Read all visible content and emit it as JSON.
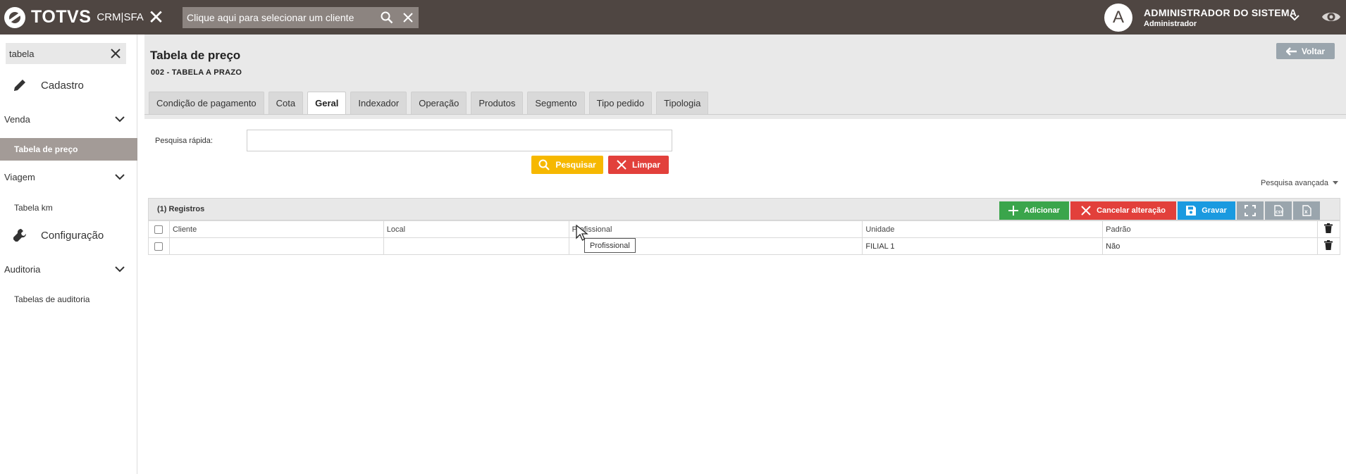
{
  "topbar": {
    "brand": "TOTVS",
    "product": "CRM|SFA",
    "client_search_placeholder": "Clique aqui para selecionar um cliente",
    "user_initial": "A",
    "user_name": "ADMINISTRADOR DO SISTEMA",
    "user_role": "Administrador"
  },
  "sidebar": {
    "search_value": "tabela",
    "items": [
      {
        "label": "Cadastro",
        "icon": "pencil-icon"
      },
      {
        "label": "Venda"
      },
      {
        "label": "Tabela de preço"
      },
      {
        "label": "Viagem"
      },
      {
        "label": "Tabela km"
      },
      {
        "label": "Configuração",
        "icon": "wrench-icon"
      },
      {
        "label": "Auditoria"
      },
      {
        "label": "Tabelas de auditoria"
      }
    ]
  },
  "page": {
    "title": "Tabela de preço",
    "subtitle": "002 - TABELA A PRAZO",
    "back_label": "Voltar"
  },
  "tabs": [
    "Condição de pagamento",
    "Cota",
    "Geral",
    "Indexador",
    "Operação",
    "Produtos",
    "Segmento",
    "Tipo pedido",
    "Tipologia"
  ],
  "active_tab": "Geral",
  "quick_search": {
    "label": "Pesquisa rápida:",
    "value": "",
    "search_label": "Pesquisar",
    "clear_label": "Limpar",
    "advanced_label": "Pesquisa avançada"
  },
  "grid": {
    "count_label": "(1) Registros",
    "add_label": "Adicionar",
    "cancel_label": "Cancelar alteração",
    "save_label": "Gravar",
    "columns": [
      "Cliente",
      "Local",
      "Profissional",
      "Unidade",
      "Padrão"
    ],
    "rows": [
      {
        "cliente": "",
        "local": "",
        "profissional": "",
        "unidade": "FILIAL 1",
        "padrao": "Não"
      }
    ],
    "tooltip": "Profissional"
  },
  "colors": {
    "topbar": "#4f4642",
    "active_side": "#a39b97",
    "search_btn": "#f6b800",
    "clear_btn": "#e2403b",
    "add_btn": "#3aa54b",
    "save_btn": "#1a9ae0"
  }
}
